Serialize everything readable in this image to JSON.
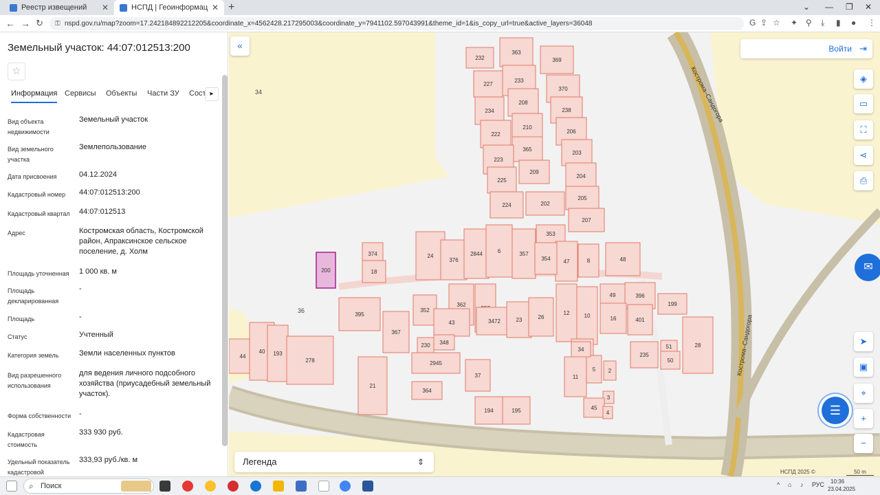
{
  "browser": {
    "tabs": [
      {
        "title": "Реестр извещений",
        "active": false
      },
      {
        "title": "НСПД | Геоинформационный п",
        "active": true
      }
    ],
    "url": "nspd.gov.ru/map?zoom=17.242184892212205&coordinate_x=4562428.217295003&coordinate_y=7941102.597043991&theme_id=1&is_copy_url=true&active_layers=36048"
  },
  "panel": {
    "title": "Земельный участок: 44:07:012513:200",
    "tabs": [
      "Информация",
      "Сервисы",
      "Объекты",
      "Части ЗУ",
      "Соста"
    ],
    "properties": [
      {
        "key": "Вид объекта недвижимости",
        "value": "Земельный участок"
      },
      {
        "key": "Вид земельного участка",
        "value": "Землепользование"
      },
      {
        "key": "Дата присвоения",
        "value": "04.12.2024"
      },
      {
        "key": "Кадастровый номер",
        "value": "44:07:012513:200"
      },
      {
        "key": "Кадастровый квартал",
        "value": "44:07:012513"
      },
      {
        "key": "Адрес",
        "value": "Костромская область, Костромской район, Апраксинское сельское поселение, д. Холм"
      },
      {
        "key": "Площадь уточненная",
        "value": "1 000 кв. м"
      },
      {
        "key": "Площадь декларированная",
        "value": "-"
      },
      {
        "key": "Площадь",
        "value": "-"
      },
      {
        "key": "Статус",
        "value": "Учтенный"
      },
      {
        "key": "Категория земель",
        "value": "Земли населенных пунктов"
      },
      {
        "key": "Вид разрешенного использования",
        "value": "для ведения личного подсобного хозяйства (приусадебный земельный участок)."
      },
      {
        "key": "Форма собственности",
        "value": "-"
      },
      {
        "key": "Кадастровая стоимость",
        "value": "333 930 руб."
      },
      {
        "key": "Удельный показатель кадастровой",
        "value": "333,93 руб./кв. м"
      }
    ]
  },
  "map": {
    "login_label": "Войти",
    "legend_label": "Легенда",
    "copyright": "НСПД 2025 ©",
    "scale_label": "50 m",
    "road_label": "Кострома–Сандогора",
    "selected_parcel": "200",
    "parcels": [
      "232",
      "363",
      "369",
      "227",
      "233",
      "370",
      "208",
      "234",
      "238",
      "222",
      "210",
      "206",
      "365",
      "203",
      "223",
      "209",
      "204",
      "225",
      "205",
      "224",
      "202",
      "207",
      "353",
      "24",
      "376",
      "2844",
      "6",
      "357",
      "47",
      "8",
      "48",
      "374",
      "18",
      "354",
      "200",
      "362",
      "397",
      "49",
      "396",
      "199",
      "395",
      "352",
      "43",
      "3472",
      "23",
      "26",
      "12",
      "10",
      "16",
      "401",
      "367",
      "230",
      "348",
      "34",
      "235",
      "51",
      "28",
      "44",
      "40",
      "193",
      "278",
      "2945",
      "5",
      "50",
      "21",
      "37",
      "11",
      "2",
      "364",
      "3",
      "194",
      "195",
      "45",
      "4",
      "36",
      "34"
    ]
  },
  "taskbar": {
    "search_label": "Поиск",
    "lang": "РУС",
    "time": "10:36",
    "date": "23.04.2025"
  }
}
